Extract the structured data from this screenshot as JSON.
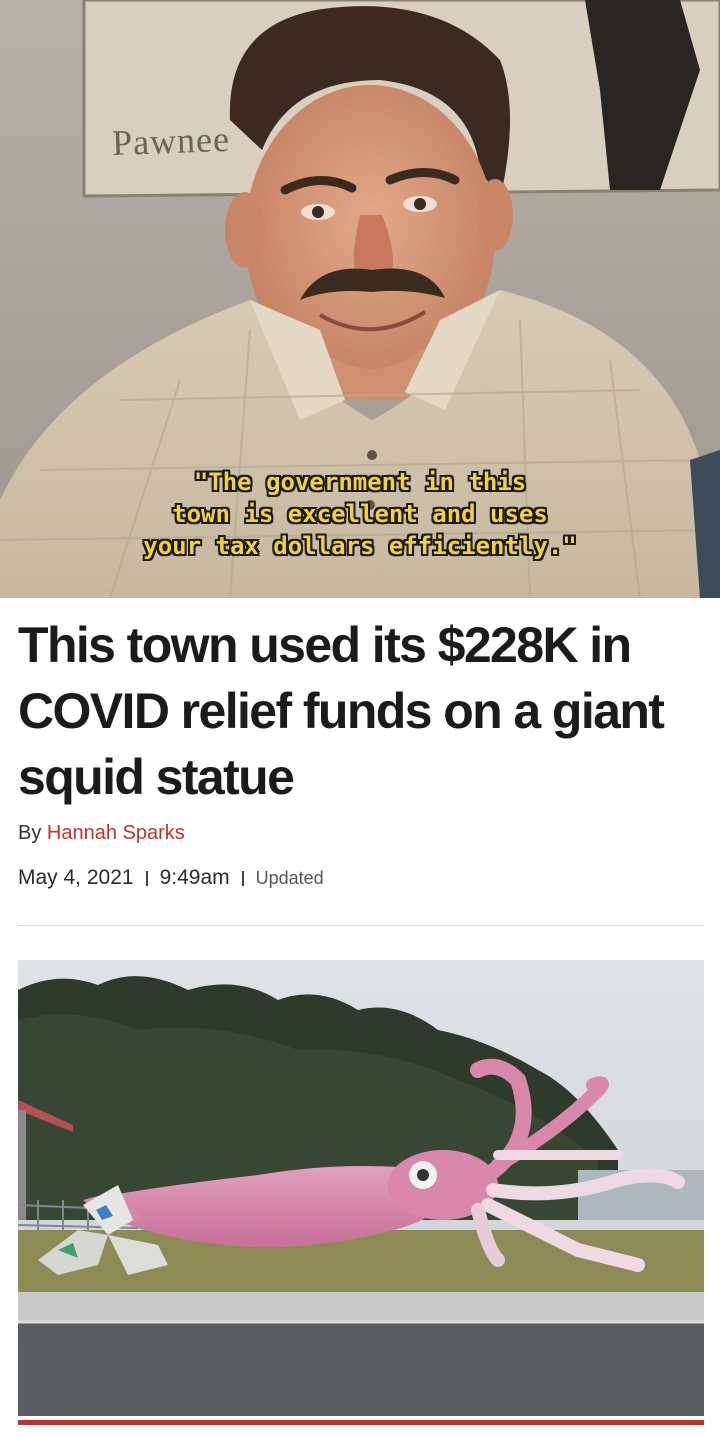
{
  "meme": {
    "sign_text": "Pawnee",
    "caption_lines": [
      "\"The government in this",
      "town is excellent and uses",
      "your tax dollars efficiently.\""
    ],
    "caption_color": "#f4d13b"
  },
  "article": {
    "headline": "This town used its $228K in COVID relief funds on a giant squid statue",
    "byline_prefix": "By",
    "author": "Hannah Sparks",
    "date": "May 4, 2021",
    "time": "9:49am",
    "updated_label": "Updated",
    "accent_color": "#c4302b"
  }
}
